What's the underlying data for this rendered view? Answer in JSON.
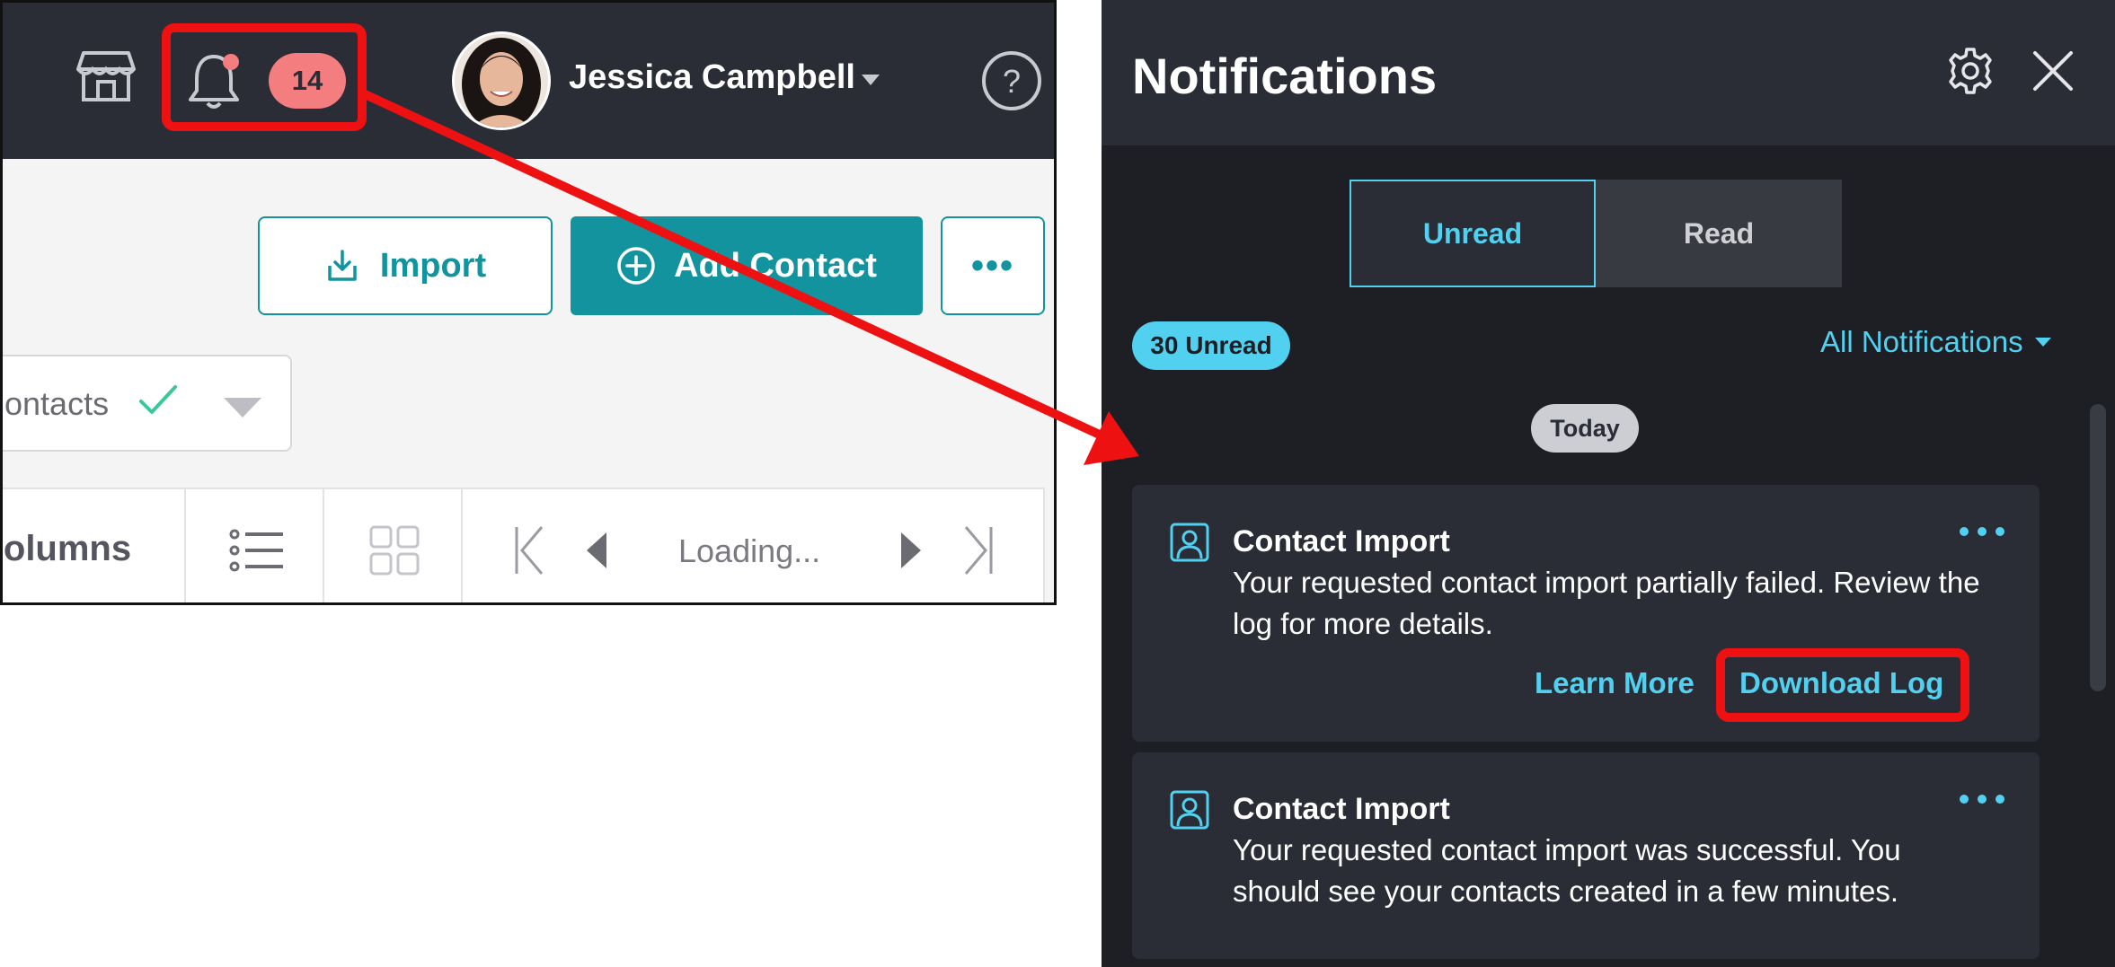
{
  "app": {
    "notification_count": "14",
    "user_name": "Jessica Campbell",
    "import_label": "Import",
    "add_contact_label": "Add Contact",
    "more_label": "•••",
    "contacts_filter_label": "ontacts",
    "columns_label": "Columns",
    "pagination_status": "Loading..."
  },
  "panel": {
    "title": "Notifications",
    "tabs": [
      {
        "label": "Unread",
        "active": true
      },
      {
        "label": "Read",
        "active": false
      }
    ],
    "unread_badge": "30 Unread",
    "filter_label": "All Notifications",
    "date_group": "Today",
    "notifications": [
      {
        "title": "Contact Import",
        "body": "Your requested contact import partially failed. Review the log for more details.",
        "actions": [
          "Learn More",
          "Download Log"
        ]
      },
      {
        "title": "Contact Import",
        "body": "Your requested contact import was successful. You should see your contacts created in a few minutes."
      }
    ]
  },
  "colors": {
    "accent_teal": "#12939d",
    "panel_accent": "#52d0f0",
    "badge_red": "#f47d80",
    "annotation_red": "#ee1111",
    "dark_header": "#2a2c36"
  },
  "icons": [
    "store-icon",
    "bell-icon",
    "chevron-down-icon",
    "help-icon",
    "download-icon",
    "plus-circle-icon",
    "check-icon",
    "list-view-icon",
    "grid-view-icon",
    "first-page-icon",
    "prev-page-icon",
    "next-page-icon",
    "last-page-icon",
    "gear-icon",
    "close-icon",
    "contact-icon",
    "more-icon"
  ]
}
